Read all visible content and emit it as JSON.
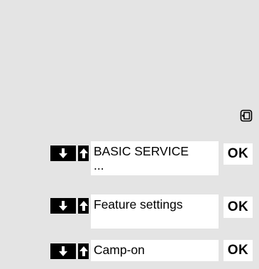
{
  "menu_key_icon": "menu-key-icon",
  "rows": [
    {
      "label_line1": "BASIC SERVICE",
      "label_line2": "...",
      "ok_label": "OK"
    },
    {
      "label_line1": "Feature settings",
      "label_line2": "",
      "ok_label": "OK"
    },
    {
      "label_line1": "Camp-on",
      "label_line2": "",
      "ok_label": "OK"
    }
  ],
  "icons": {
    "down": "arrow-down-icon",
    "up": "arrow-up-icon"
  }
}
